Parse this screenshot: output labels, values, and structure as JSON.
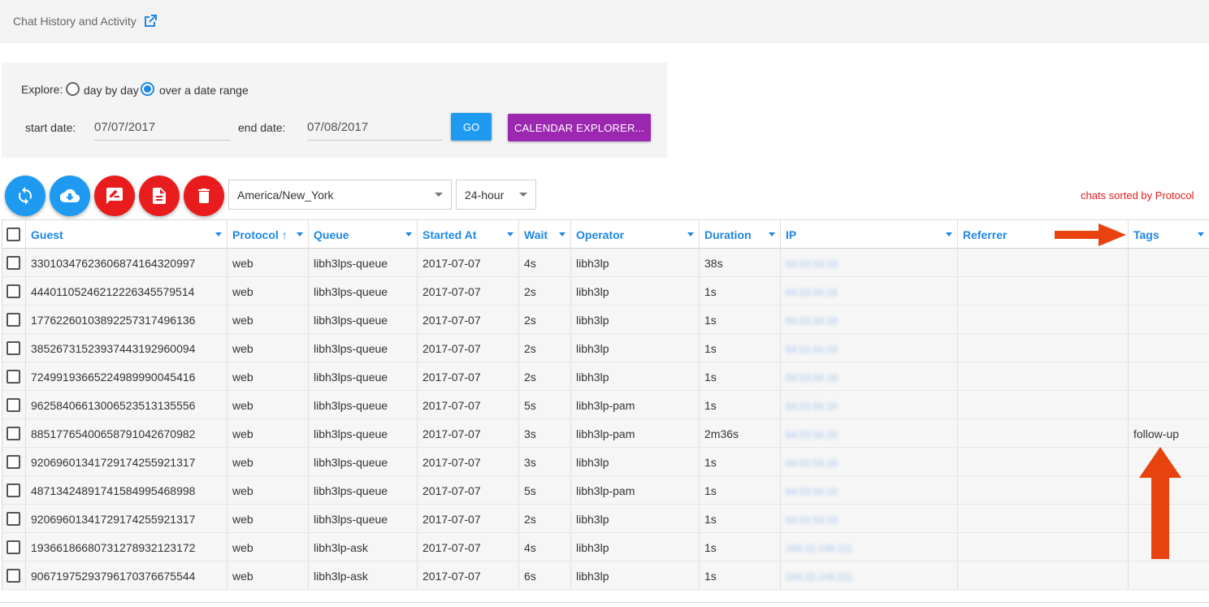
{
  "header": {
    "title": "Chat History and Activity",
    "external_icon": "external-link-icon"
  },
  "explore": {
    "label": "Explore:",
    "option_day": "day by day",
    "option_range": "over a date range",
    "selected": "over a date range",
    "start_label": "start date:",
    "start_value": "07/07/2017",
    "end_label": "end date:",
    "end_value": "07/08/2017",
    "go_label": "GO",
    "calendar_label": "CALENDAR EXPLORER..."
  },
  "toolbar": {
    "buttons": [
      "refresh-icon",
      "cloud-download-icon",
      "report-icon",
      "document-icon",
      "trash-icon"
    ],
    "timezone": "America/New_York",
    "clock": "24-hour",
    "sort_note": "chats sorted by Protocol",
    "colors": {
      "blue": "#1e9af0",
      "red": "#e81c1c",
      "purple": "#9c27b0",
      "note": "#e51c1c"
    }
  },
  "table": {
    "columns": [
      "Guest",
      "Protocol ↑",
      "Queue",
      "Started At",
      "Wait",
      "Operator",
      "Duration",
      "IP",
      "Referrer",
      "Tags"
    ],
    "rows": [
      [
        "33010347623606874164320997",
        "web",
        "libh3lps-queue",
        "2017-07-07",
        "4s",
        "libh3lp",
        "38s",
        "64.53.54.18",
        "",
        ""
      ],
      [
        "44401105246212226345579514",
        "web",
        "libh3lps-queue",
        "2017-07-07",
        "2s",
        "libh3lp",
        "1s",
        "64.53.54.18",
        "",
        ""
      ],
      [
        "17762260103892257317496136",
        "web",
        "libh3lps-queue",
        "2017-07-07",
        "2s",
        "libh3lp",
        "1s",
        "64.53.54.18",
        "",
        ""
      ],
      [
        "38526731523937443192960094",
        "web",
        "libh3lps-queue",
        "2017-07-07",
        "2s",
        "libh3lp",
        "1s",
        "64.53.54.18",
        "",
        ""
      ],
      [
        "72499193665224989990045416",
        "web",
        "libh3lps-queue",
        "2017-07-07",
        "2s",
        "libh3lp",
        "1s",
        "64.53.54.18",
        "",
        ""
      ],
      [
        "96258406613006523513135556",
        "web",
        "libh3lps-queue",
        "2017-07-07",
        "5s",
        "libh3lp-pam",
        "1s",
        "64.53.54.18",
        "",
        ""
      ],
      [
        "88517765400658791042670982",
        "web",
        "libh3lps-queue",
        "2017-07-07",
        "3s",
        "libh3lp-pam",
        "2m36s",
        "64.53.54.18",
        "",
        "follow-up"
      ],
      [
        "92069601341729174255921317",
        "web",
        "libh3lps-queue",
        "2017-07-07",
        "3s",
        "libh3lp",
        "1s",
        "64.53.54.18",
        "",
        ""
      ],
      [
        "48713424891741584995468998",
        "web",
        "libh3lps-queue",
        "2017-07-07",
        "5s",
        "libh3lp-pam",
        "1s",
        "64.53.54.18",
        "",
        ""
      ],
      [
        "92069601341729174255921317",
        "web",
        "libh3lps-queue",
        "2017-07-07",
        "2s",
        "libh3lp",
        "1s",
        "64.53.54.18",
        "",
        ""
      ],
      [
        "19366186680731278932123172",
        "web",
        "libh3lp-ask",
        "2017-07-07",
        "4s",
        "libh3lp",
        "1s",
        "184.15.149.211",
        "",
        ""
      ],
      [
        "90671975293796170376675544",
        "web",
        "libh3lp-ask",
        "2017-07-07",
        "6s",
        "libh3lp",
        "1s",
        "184.15.149.211",
        "",
        ""
      ]
    ]
  },
  "annotations": {
    "arrow_color": "#e8430e"
  }
}
